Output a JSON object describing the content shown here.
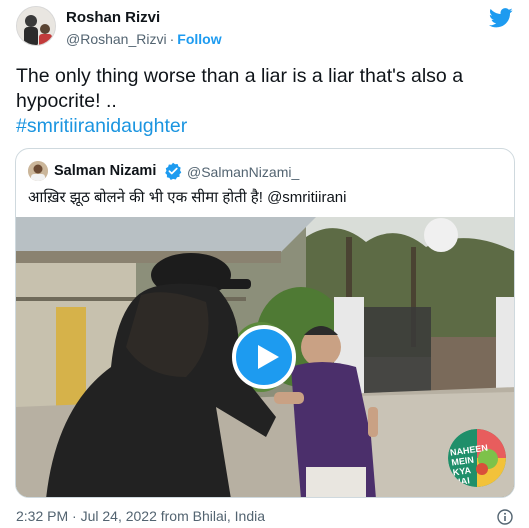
{
  "author": {
    "name": "Roshan Rizvi",
    "handle": "@Roshan_Rizvi",
    "separator": "·",
    "follow_label": "Follow"
  },
  "tweet": {
    "text": "The only thing worse than a liar is a liar that's also a hypocrite! ..",
    "hashtag": "#smritiiranidaughter"
  },
  "quoted": {
    "name": "Salman Nizami",
    "handle": "@SalmanNizami_",
    "text": "आख़िर झूठ बोलने की भी एक सीमा होती है! @smritiirani",
    "media": "video",
    "channel_logo_text": [
      "NAHEEN",
      "MEIN",
      "KYA",
      "HAI"
    ]
  },
  "meta": {
    "timestamp": "2:32 PM · Jul 24, 2022 from Bhilai, India"
  },
  "icons": {
    "brand": "twitter-bird-icon",
    "verified": "verified-badge-icon",
    "play": "play-icon",
    "info": "info-icon"
  },
  "colors": {
    "accent": "#1d9bf0",
    "hashtag": "#1b95e0",
    "text": "#0f1419",
    "secondary": "#536471",
    "border": "#cfd9de"
  }
}
